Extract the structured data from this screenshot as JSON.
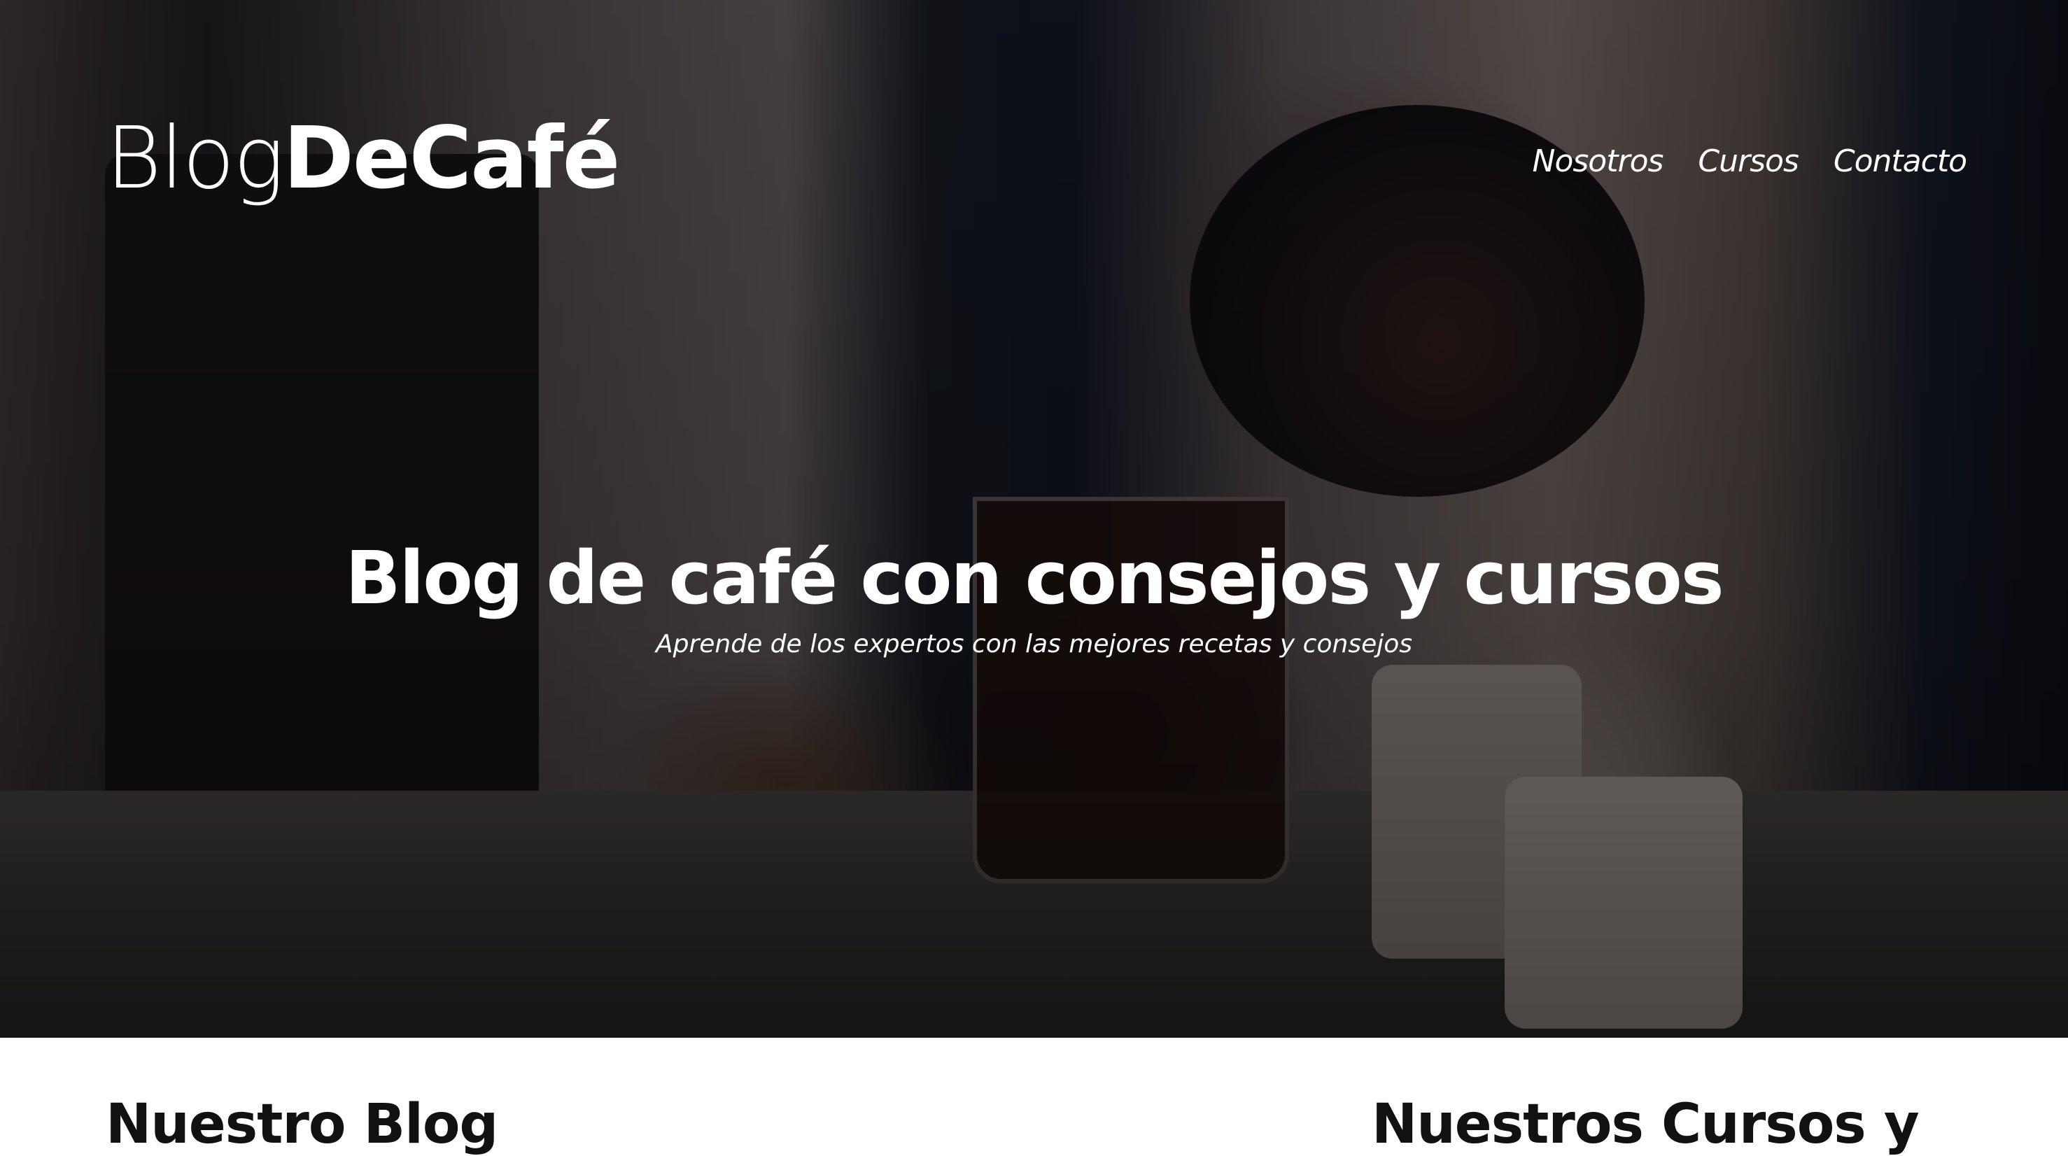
{
  "header": {
    "logo_light": "Blog",
    "logo_bold": "DeCafé",
    "nav": [
      "Nosotros",
      "Cursos",
      "Contacto"
    ]
  },
  "hero": {
    "title": "Blog de café con consejos y cursos",
    "subtitle": "Aprende de los expertos con las mejores recetas y consejos"
  },
  "sections": {
    "blog_heading": "Nuestro Blog",
    "courses_heading": "Nuestros Cursos y"
  }
}
